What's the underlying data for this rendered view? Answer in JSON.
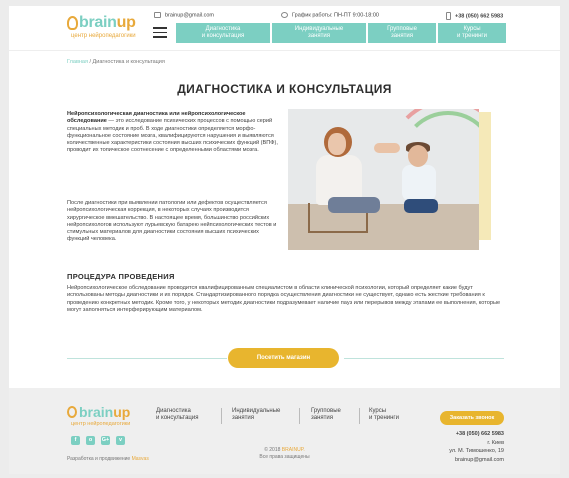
{
  "header": {
    "logo_word_main": "brain",
    "logo_word_accent": "up",
    "logo_sub": "центр нейропедагогики",
    "email": "brainup@gmail.com",
    "schedule": "График работы: ПН-ПТ 9:00-18:00",
    "phone": "+38 (050) 662 5983",
    "nav": [
      {
        "line1": "Диагностика",
        "line2": "и консультация"
      },
      {
        "line1": "Индивидуальные",
        "line2": "занятия"
      },
      {
        "line1": "Групповые",
        "line2": "занятия"
      },
      {
        "line1": "Курсы",
        "line2": "и тренинги"
      }
    ]
  },
  "breadcrumb": {
    "home": "Главная",
    "sep": " / ",
    "current": "Диагностика и консультация"
  },
  "page_title": "ДИАГНОСТИКА И КОНСУЛЬТАЦИЯ",
  "intro": {
    "bold": "Нейропсихологическая диагностика или нейропсихологическое обследование",
    "rest": " — это исследование психических процессов с помощью серий специальных методик и проб. В ходе диагностики определяется морфо-функциональное состояние мозга, квалифицируются нарушения и выявляются количественные характеристики состояния высших психических функций (ВПФ), проводит их топическое соотнесение с определенными областями мозга."
  },
  "para2": "После диагностики при выявлении патологии или дефектов осуществляется нейропсихологическая коррекция, в некоторых случаях производится хирургическое вмешательство. В настоящее время, большинство российских нейропсихологов используют лурьевскую батарею нейпсихологических тестов и стимульных материалов для диагностики состояния высших психических функций человека.",
  "procedure": {
    "title": "ПРОЦЕДУРА ПРОВЕДЕНИЯ",
    "text": "Нейропсихологическое обследование проводится квалифицированным специалистом в области клинической психологии, который определяет какие будут использованы методы диагностики и их порядок. Стандартизированного порядка осуществления диагностики не существует, однако есть жесткие требования к проведению конкретных методик. Кроме того, у некоторых методик диагностики подразумевает наличие пауз или перерывов между этапами ее выполнения, которые могут заполняться интерферирующим материалом."
  },
  "cta_button": "Посетить магазин",
  "footer": {
    "nav": [
      {
        "line1": "Диагностика",
        "line2": "и консультация"
      },
      {
        "line1": "Индивидуальные",
        "line2": "занятия"
      },
      {
        "line1": "Групповые",
        "line2": "занятия"
      },
      {
        "line1": "Курсы",
        "line2": "и тренинги"
      }
    ],
    "call_button": "Заказать звонок",
    "phone": "+38 (050) 662 5983",
    "city": "г. Киев",
    "street": "ул. М. Тимошенко, 19",
    "email": "brainup@gmail.com",
    "copyright": "© 2018",
    "copyright_brand": "BRAINUP.",
    "rights": "Все права защищены",
    "dev_text": "Разработка и продвижение",
    "dev_brand": "Masvas",
    "social": [
      "f",
      "o",
      "G+",
      "v"
    ]
  },
  "colors": {
    "accent": "#7ccfc2",
    "brand_orange": "#e8b52e"
  }
}
